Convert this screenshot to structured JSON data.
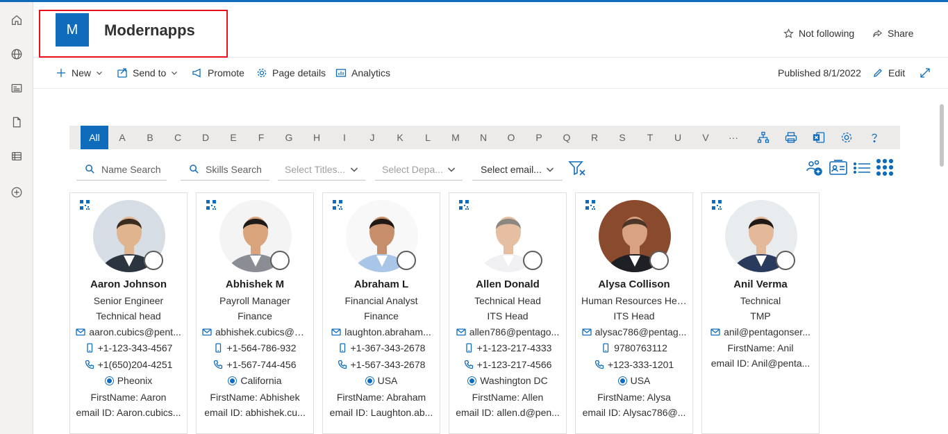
{
  "site": {
    "logo_letter": "M",
    "title": "Modernapps"
  },
  "header_actions": {
    "follow": "Not following",
    "share": "Share"
  },
  "commands": {
    "new": "New",
    "send_to": "Send to",
    "promote": "Promote",
    "page_details": "Page details",
    "analytics": "Analytics",
    "published": "Published 8/1/2022",
    "edit": "Edit"
  },
  "alphabet": [
    "All",
    "A",
    "B",
    "C",
    "D",
    "E",
    "F",
    "G",
    "H",
    "I",
    "J",
    "K",
    "L",
    "M",
    "N",
    "O",
    "P",
    "Q",
    "R",
    "S",
    "T",
    "U",
    "V",
    "···"
  ],
  "filters": {
    "name_search": "Name Search",
    "skills_search": "Skills Search",
    "titles": "Select Titles...",
    "departments": "Select Depa...",
    "email": "Select email..."
  },
  "cards": [
    {
      "name": "Aaron Johnson",
      "title": "Senior Engineer",
      "dept": "Technical head",
      "email": "aaron.cubics@pent...",
      "phone": "+1-123-343-4567",
      "phone2": "+1(650)204-4251",
      "location": "Pheonix",
      "first": "FirstName: Aaron",
      "emailid": "email ID: Aaron.cubics..."
    },
    {
      "name": "Abhishek M",
      "title": "Payroll Manager",
      "dept": "Finance",
      "email": "abhishek.cubics@p...",
      "phone": "+1-564-786-932",
      "phone2": "+1-567-744-456",
      "location": "California",
      "first": "FirstName: Abhishek",
      "emailid": "email ID: abhishek.cu..."
    },
    {
      "name": "Abraham L",
      "title": "Financial Analyst",
      "dept": "Finance",
      "email": "laughton.abraham...",
      "phone": "+1-367-343-2678",
      "phone2": "+1-567-343-2678",
      "location": "USA",
      "first": "FirstName: Abraham",
      "emailid": "email ID: Laughton.ab..."
    },
    {
      "name": "Allen Donald",
      "title": "Technical Head",
      "dept": "ITS Head",
      "email": "allen786@pentago...",
      "phone": "+1-123-217-4333",
      "phone2": "+1-123-217-4566",
      "location": "Washington DC",
      "first": "FirstName: Allen",
      "emailid": "email ID: allen.d@pen..."
    },
    {
      "name": "Alysa Collison",
      "title": "Human Resources Head",
      "dept": "ITS Head",
      "email": "alysac786@pentag...",
      "phone": "9780763112",
      "phone2": "+123-333-1201",
      "location": "USA",
      "first": "FirstName: Alysa",
      "emailid": "email ID: Alysac786@..."
    },
    {
      "name": "Anil Verma",
      "title": "Technical",
      "dept": "TMP",
      "email": "anil@pentagonser...",
      "first": "FirstName: Anil",
      "emailid": "email ID: Anil@penta..."
    }
  ],
  "colors": {
    "accent": "#0f6cbd",
    "highlight_box": "#e8101a"
  }
}
